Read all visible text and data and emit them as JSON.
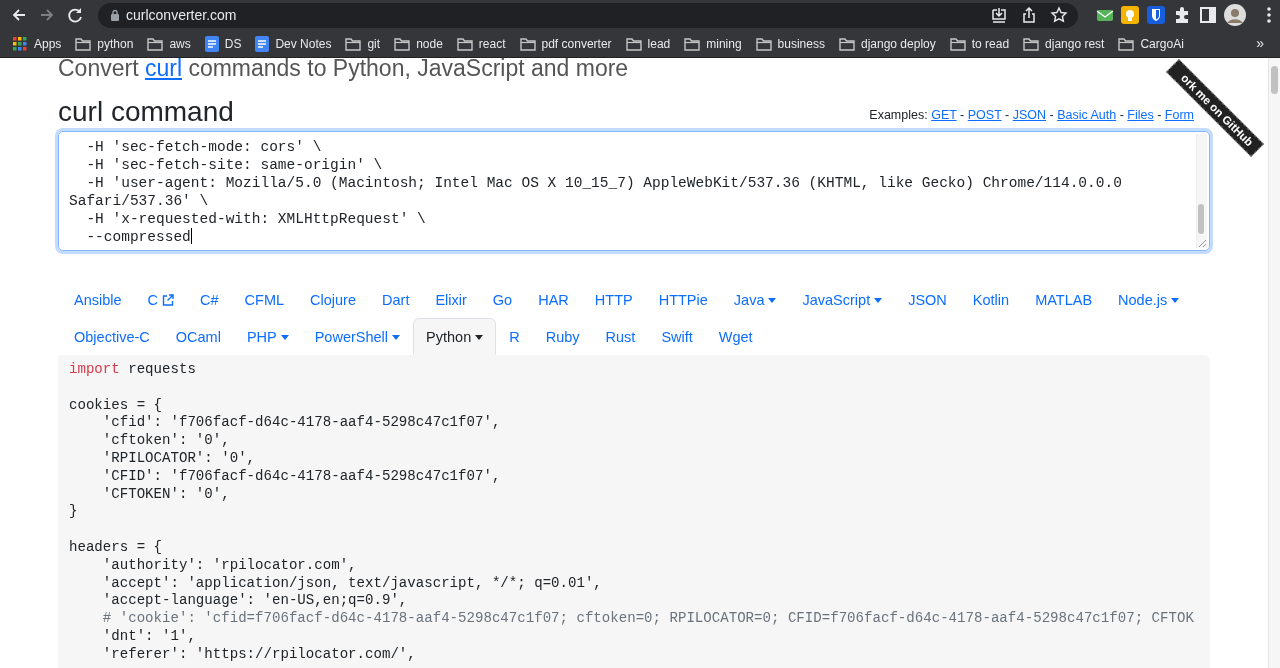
{
  "browser": {
    "url": "curlconverter.com",
    "bookmarks": [
      {
        "label": "Apps",
        "kind": "apps"
      },
      {
        "label": "python",
        "kind": "folder"
      },
      {
        "label": "aws",
        "kind": "folder"
      },
      {
        "label": "DS",
        "kind": "doc"
      },
      {
        "label": "Dev Notes",
        "kind": "doc"
      },
      {
        "label": "git",
        "kind": "folder"
      },
      {
        "label": "node",
        "kind": "folder"
      },
      {
        "label": "react",
        "kind": "folder"
      },
      {
        "label": "pdf converter",
        "kind": "folder"
      },
      {
        "label": "lead",
        "kind": "folder"
      },
      {
        "label": "mining",
        "kind": "folder"
      },
      {
        "label": "business",
        "kind": "folder"
      },
      {
        "label": "django deploy",
        "kind": "folder"
      },
      {
        "label": "to read",
        "kind": "folder"
      },
      {
        "label": "django rest",
        "kind": "folder"
      },
      {
        "label": "CargoAi",
        "kind": "folder"
      }
    ],
    "more": "»"
  },
  "page": {
    "tagline": {
      "before": "Convert ",
      "link": "curl",
      "after": " commands to Python, JavaScript and more"
    },
    "heading": "curl command",
    "examples": {
      "label": "Examples:",
      "separator": "-",
      "links": [
        "GET",
        "POST",
        "JSON",
        "Basic Auth",
        "Files",
        "Form"
      ]
    },
    "ribbon": "ork me on GitHub",
    "curl_lines": [
      "  -H 'sec-fetch-mode: cors' \\",
      "  -H 'sec-fetch-site: same-origin' \\",
      "  -H 'user-agent: Mozilla/5.0 (Macintosh; Intel Mac OS X 10_15_7) AppleWebKit/537.36 (KHTML, like Gecko) Chrome/114.0.0.0 Safari/537.36' \\",
      "  -H 'x-requested-with: XMLHttpRequest' \\",
      "  --compressed"
    ],
    "tabs": [
      {
        "label": "Ansible",
        "selected": false,
        "dropdown": false,
        "external": false
      },
      {
        "label": "C",
        "selected": false,
        "dropdown": false,
        "external": true
      },
      {
        "label": "C#",
        "selected": false,
        "dropdown": false,
        "external": false
      },
      {
        "label": "CFML",
        "selected": false,
        "dropdown": false,
        "external": false
      },
      {
        "label": "Clojure",
        "selected": false,
        "dropdown": false,
        "external": false
      },
      {
        "label": "Dart",
        "selected": false,
        "dropdown": false,
        "external": false
      },
      {
        "label": "Elixir",
        "selected": false,
        "dropdown": false,
        "external": false
      },
      {
        "label": "Go",
        "selected": false,
        "dropdown": false,
        "external": false
      },
      {
        "label": "HAR",
        "selected": false,
        "dropdown": false,
        "external": false
      },
      {
        "label": "HTTP",
        "selected": false,
        "dropdown": false,
        "external": false
      },
      {
        "label": "HTTPie",
        "selected": false,
        "dropdown": false,
        "external": false
      },
      {
        "label": "Java",
        "selected": false,
        "dropdown": true,
        "external": false
      },
      {
        "label": "JavaScript",
        "selected": false,
        "dropdown": true,
        "external": false
      },
      {
        "label": "JSON",
        "selected": false,
        "dropdown": false,
        "external": false
      },
      {
        "label": "Kotlin",
        "selected": false,
        "dropdown": false,
        "external": false
      },
      {
        "label": "MATLAB",
        "selected": false,
        "dropdown": false,
        "external": false
      },
      {
        "label": "Node.js",
        "selected": false,
        "dropdown": true,
        "external": false
      },
      {
        "label": "Objective-C",
        "selected": false,
        "dropdown": false,
        "external": false
      },
      {
        "label": "OCaml",
        "selected": false,
        "dropdown": false,
        "external": false
      },
      {
        "label": "PHP",
        "selected": false,
        "dropdown": true,
        "external": false
      },
      {
        "label": "PowerShell",
        "selected": false,
        "dropdown": true,
        "external": false
      },
      {
        "label": "Python",
        "selected": true,
        "dropdown": true,
        "external": false
      },
      {
        "label": "R",
        "selected": false,
        "dropdown": false,
        "external": false
      },
      {
        "label": "Ruby",
        "selected": false,
        "dropdown": false,
        "external": false
      },
      {
        "label": "Rust",
        "selected": false,
        "dropdown": false,
        "external": false
      },
      {
        "label": "Swift",
        "selected": false,
        "dropdown": false,
        "external": false
      },
      {
        "label": "Wget",
        "selected": false,
        "dropdown": false,
        "external": false
      }
    ],
    "code_lines": [
      {
        "kind": "code",
        "segments": [
          {
            "kind": "keyword",
            "text": "import"
          },
          {
            "kind": "plain",
            "text": " requests"
          }
        ]
      },
      {
        "kind": "blank"
      },
      {
        "kind": "code",
        "segments": [
          {
            "kind": "plain",
            "text": "cookies = {"
          }
        ]
      },
      {
        "kind": "code",
        "segments": [
          {
            "kind": "plain",
            "text": "    'cfid': 'f706facf-d64c-4178-aaf4-5298c47c1f07',"
          }
        ]
      },
      {
        "kind": "code",
        "segments": [
          {
            "kind": "plain",
            "text": "    'cftoken': '0',"
          }
        ]
      },
      {
        "kind": "code",
        "segments": [
          {
            "kind": "plain",
            "text": "    'RPILOCATOR': '0',"
          }
        ]
      },
      {
        "kind": "code",
        "segments": [
          {
            "kind": "plain",
            "text": "    'CFID': 'f706facf-d64c-4178-aaf4-5298c47c1f07',"
          }
        ]
      },
      {
        "kind": "code",
        "segments": [
          {
            "kind": "plain",
            "text": "    'CFTOKEN': '0',"
          }
        ]
      },
      {
        "kind": "code",
        "segments": [
          {
            "kind": "plain",
            "text": "}"
          }
        ]
      },
      {
        "kind": "blank"
      },
      {
        "kind": "code",
        "segments": [
          {
            "kind": "plain",
            "text": "headers = {"
          }
        ]
      },
      {
        "kind": "code",
        "segments": [
          {
            "kind": "plain",
            "text": "    'authority': 'rpilocator.com',"
          }
        ]
      },
      {
        "kind": "code",
        "segments": [
          {
            "kind": "plain",
            "text": "    'accept': 'application/json, text/javascript, */*; q=0.01',"
          }
        ]
      },
      {
        "kind": "code",
        "segments": [
          {
            "kind": "plain",
            "text": "    'accept-language': 'en-US,en;q=0.9',"
          }
        ]
      },
      {
        "kind": "code",
        "segments": [
          {
            "kind": "comment",
            "text": "    # 'cookie': 'cfid=f706facf-d64c-4178-aaf4-5298c47c1f07; cftoken=0; RPILOCATOR=0; CFID=f706facf-d64c-4178-aaf4-5298c47c1f07; CFTOK"
          }
        ]
      },
      {
        "kind": "code",
        "segments": [
          {
            "kind": "plain",
            "text": "    'dnt': '1',"
          }
        ]
      },
      {
        "kind": "code",
        "segments": [
          {
            "kind": "plain",
            "text": "    'referer': 'https://rpilocator.com/',"
          }
        ]
      }
    ]
  }
}
